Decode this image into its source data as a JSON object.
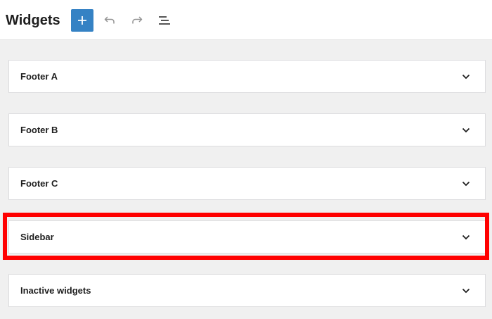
{
  "header": {
    "title": "Widgets",
    "add_button_icon": "plus-icon",
    "undo_icon": "undo-icon",
    "redo_icon": "redo-icon",
    "list_view_icon": "list-view-icon",
    "accent_color": "#3582c4"
  },
  "panels": [
    {
      "label": "Footer A",
      "icon": "chevron-down-icon"
    },
    {
      "label": "Footer B",
      "icon": "chevron-down-icon"
    },
    {
      "label": "Footer C",
      "icon": "chevron-down-icon"
    },
    {
      "label": "Sidebar",
      "icon": "chevron-down-icon",
      "highlighted": true
    },
    {
      "label": "Inactive widgets",
      "icon": "chevron-down-icon"
    }
  ],
  "highlight_color": "#ff0000"
}
